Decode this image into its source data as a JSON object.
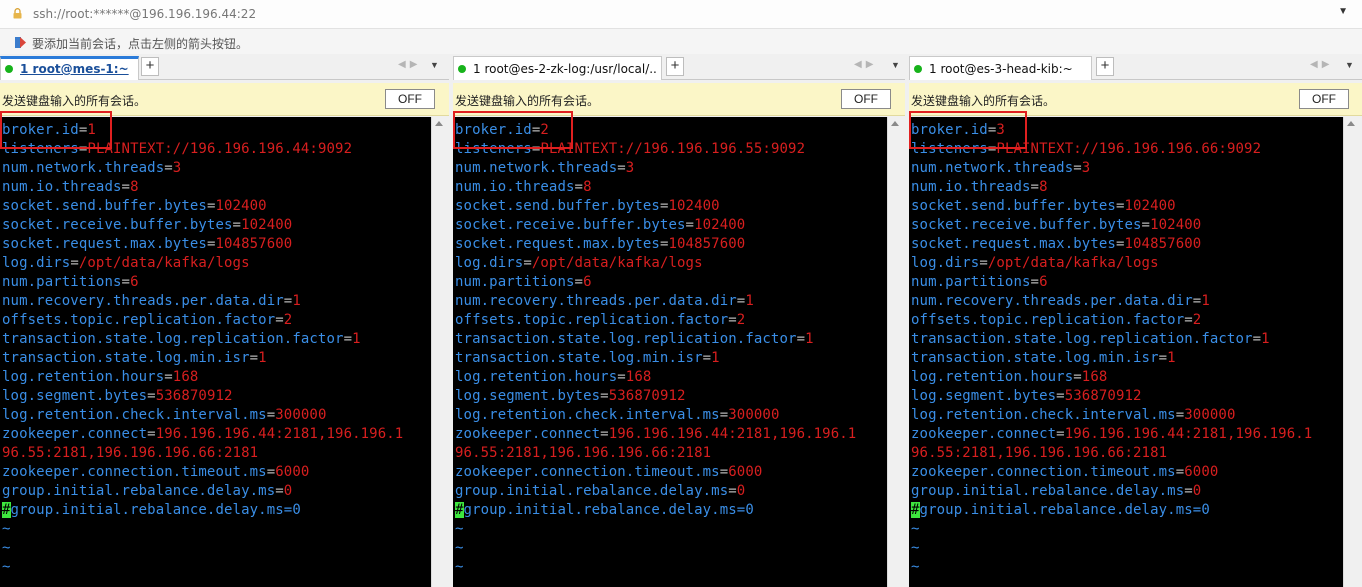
{
  "address_bar": {
    "url": "ssh://root:******@196.196.196.44:22"
  },
  "hint": "要添加当前会话，点击左侧的箭头按钮。",
  "send_bar": {
    "message": "发送键盘输入的所有会话。",
    "toggle_label": "OFF"
  },
  "add_tab_label": "+",
  "colors": {
    "key": "#3a8ee6",
    "value": "#d81f1f",
    "equals": "#b6b6b6",
    "cursor": "#3ee63e",
    "active_tab": "#2b7bd9",
    "send_bar_bg": "#fbf6c7",
    "highlight": "#e02020"
  },
  "panes": [
    {
      "tab_label": "1 root@mes-1:~",
      "active": true,
      "lines": [
        {
          "k": "broker.id",
          "v": "1"
        },
        {
          "k": "listeners",
          "v": "PLAINTEXT://196.196.196.44:9092"
        },
        {
          "k": "num.network.threads",
          "v": "3"
        },
        {
          "k": "num.io.threads",
          "v": "8"
        },
        {
          "k": "socket.send.buffer.bytes",
          "v": "102400"
        },
        {
          "k": "socket.receive.buffer.bytes",
          "v": "102400"
        },
        {
          "k": "socket.request.max.bytes",
          "v": "104857600"
        },
        {
          "k": "log.dirs",
          "v": "/opt/data/kafka/logs"
        },
        {
          "k": "num.partitions",
          "v": "6"
        },
        {
          "k": "num.recovery.threads.per.data.dir",
          "v": "1"
        },
        {
          "k": "offsets.topic.replication.factor",
          "v": "2"
        },
        {
          "k": "transaction.state.log.replication.factor",
          "v": "1"
        },
        {
          "k": "transaction.state.log.min.isr",
          "v": "1"
        },
        {
          "k": "log.retention.hours",
          "v": "168"
        },
        {
          "k": "log.segment.bytes",
          "v": "536870912"
        },
        {
          "k": "log.retention.check.interval.ms",
          "v": "300000"
        },
        {
          "k": "zookeeper.connect",
          "v": "196.196.196.44:2181,196.196.1"
        },
        {
          "k": "",
          "v": "96.55:2181,196.196.196.66:2181"
        },
        {
          "k": "zookeeper.connection.timeout.ms",
          "v": "6000"
        },
        {
          "k": "group.initial.rebalance.delay.ms",
          "v": "0"
        },
        {
          "cursor": "#",
          "rest": "group.initial.rebalance.delay.ms=0"
        },
        {
          "tilde": "~"
        },
        {
          "tilde": "~"
        },
        {
          "tilde": "~"
        }
      ]
    },
    {
      "tab_label": "1 root@es-2-zk-log:/usr/local/...",
      "active": false,
      "lines": [
        {
          "k": "broker.id",
          "v": "2"
        },
        {
          "k": "listeners",
          "v": "PLAINTEXT://196.196.196.55:9092"
        },
        {
          "k": "num.network.threads",
          "v": "3"
        },
        {
          "k": "num.io.threads",
          "v": "8"
        },
        {
          "k": "socket.send.buffer.bytes",
          "v": "102400"
        },
        {
          "k": "socket.receive.buffer.bytes",
          "v": "102400"
        },
        {
          "k": "socket.request.max.bytes",
          "v": "104857600"
        },
        {
          "k": "log.dirs",
          "v": "/opt/data/kafka/logs"
        },
        {
          "k": "num.partitions",
          "v": "6"
        },
        {
          "k": "num.recovery.threads.per.data.dir",
          "v": "1"
        },
        {
          "k": "offsets.topic.replication.factor",
          "v": "2"
        },
        {
          "k": "transaction.state.log.replication.factor",
          "v": "1"
        },
        {
          "k": "transaction.state.log.min.isr",
          "v": "1"
        },
        {
          "k": "log.retention.hours",
          "v": "168"
        },
        {
          "k": "log.segment.bytes",
          "v": "536870912"
        },
        {
          "k": "log.retention.check.interval.ms",
          "v": "300000"
        },
        {
          "k": "zookeeper.connect",
          "v": "196.196.196.44:2181,196.196.1"
        },
        {
          "k": "",
          "v": "96.55:2181,196.196.196.66:2181"
        },
        {
          "k": "zookeeper.connection.timeout.ms",
          "v": "6000"
        },
        {
          "k": "group.initial.rebalance.delay.ms",
          "v": "0"
        },
        {
          "cursor": "#",
          "rest": "group.initial.rebalance.delay.ms=0"
        },
        {
          "tilde": "~"
        },
        {
          "tilde": "~"
        },
        {
          "tilde": "~"
        }
      ]
    },
    {
      "tab_label": "1 root@es-3-head-kib:~",
      "active": false,
      "lines": [
        {
          "k": "broker.id",
          "v": "3"
        },
        {
          "k": "listeners",
          "v": "PLAINTEXT://196.196.196.66:9092"
        },
        {
          "k": "num.network.threads",
          "v": "3"
        },
        {
          "k": "num.io.threads",
          "v": "8"
        },
        {
          "k": "socket.send.buffer.bytes",
          "v": "102400"
        },
        {
          "k": "socket.receive.buffer.bytes",
          "v": "102400"
        },
        {
          "k": "socket.request.max.bytes",
          "v": "104857600"
        },
        {
          "k": "log.dirs",
          "v": "/opt/data/kafka/logs"
        },
        {
          "k": "num.partitions",
          "v": "6"
        },
        {
          "k": "num.recovery.threads.per.data.dir",
          "v": "1"
        },
        {
          "k": "offsets.topic.replication.factor",
          "v": "2"
        },
        {
          "k": "transaction.state.log.replication.factor",
          "v": "1"
        },
        {
          "k": "transaction.state.log.min.isr",
          "v": "1"
        },
        {
          "k": "log.retention.hours",
          "v": "168"
        },
        {
          "k": "log.segment.bytes",
          "v": "536870912"
        },
        {
          "k": "log.retention.check.interval.ms",
          "v": "300000"
        },
        {
          "k": "zookeeper.connect",
          "v": "196.196.196.44:2181,196.196.1"
        },
        {
          "k": "",
          "v": "96.55:2181,196.196.196.66:2181"
        },
        {
          "k": "zookeeper.connection.timeout.ms",
          "v": "6000"
        },
        {
          "k": "group.initial.rebalance.delay.ms",
          "v": "0"
        },
        {
          "cursor": "#",
          "rest": "group.initial.rebalance.delay.ms=0"
        },
        {
          "tilde": "~"
        },
        {
          "tilde": "~"
        },
        {
          "tilde": "~"
        }
      ]
    }
  ]
}
